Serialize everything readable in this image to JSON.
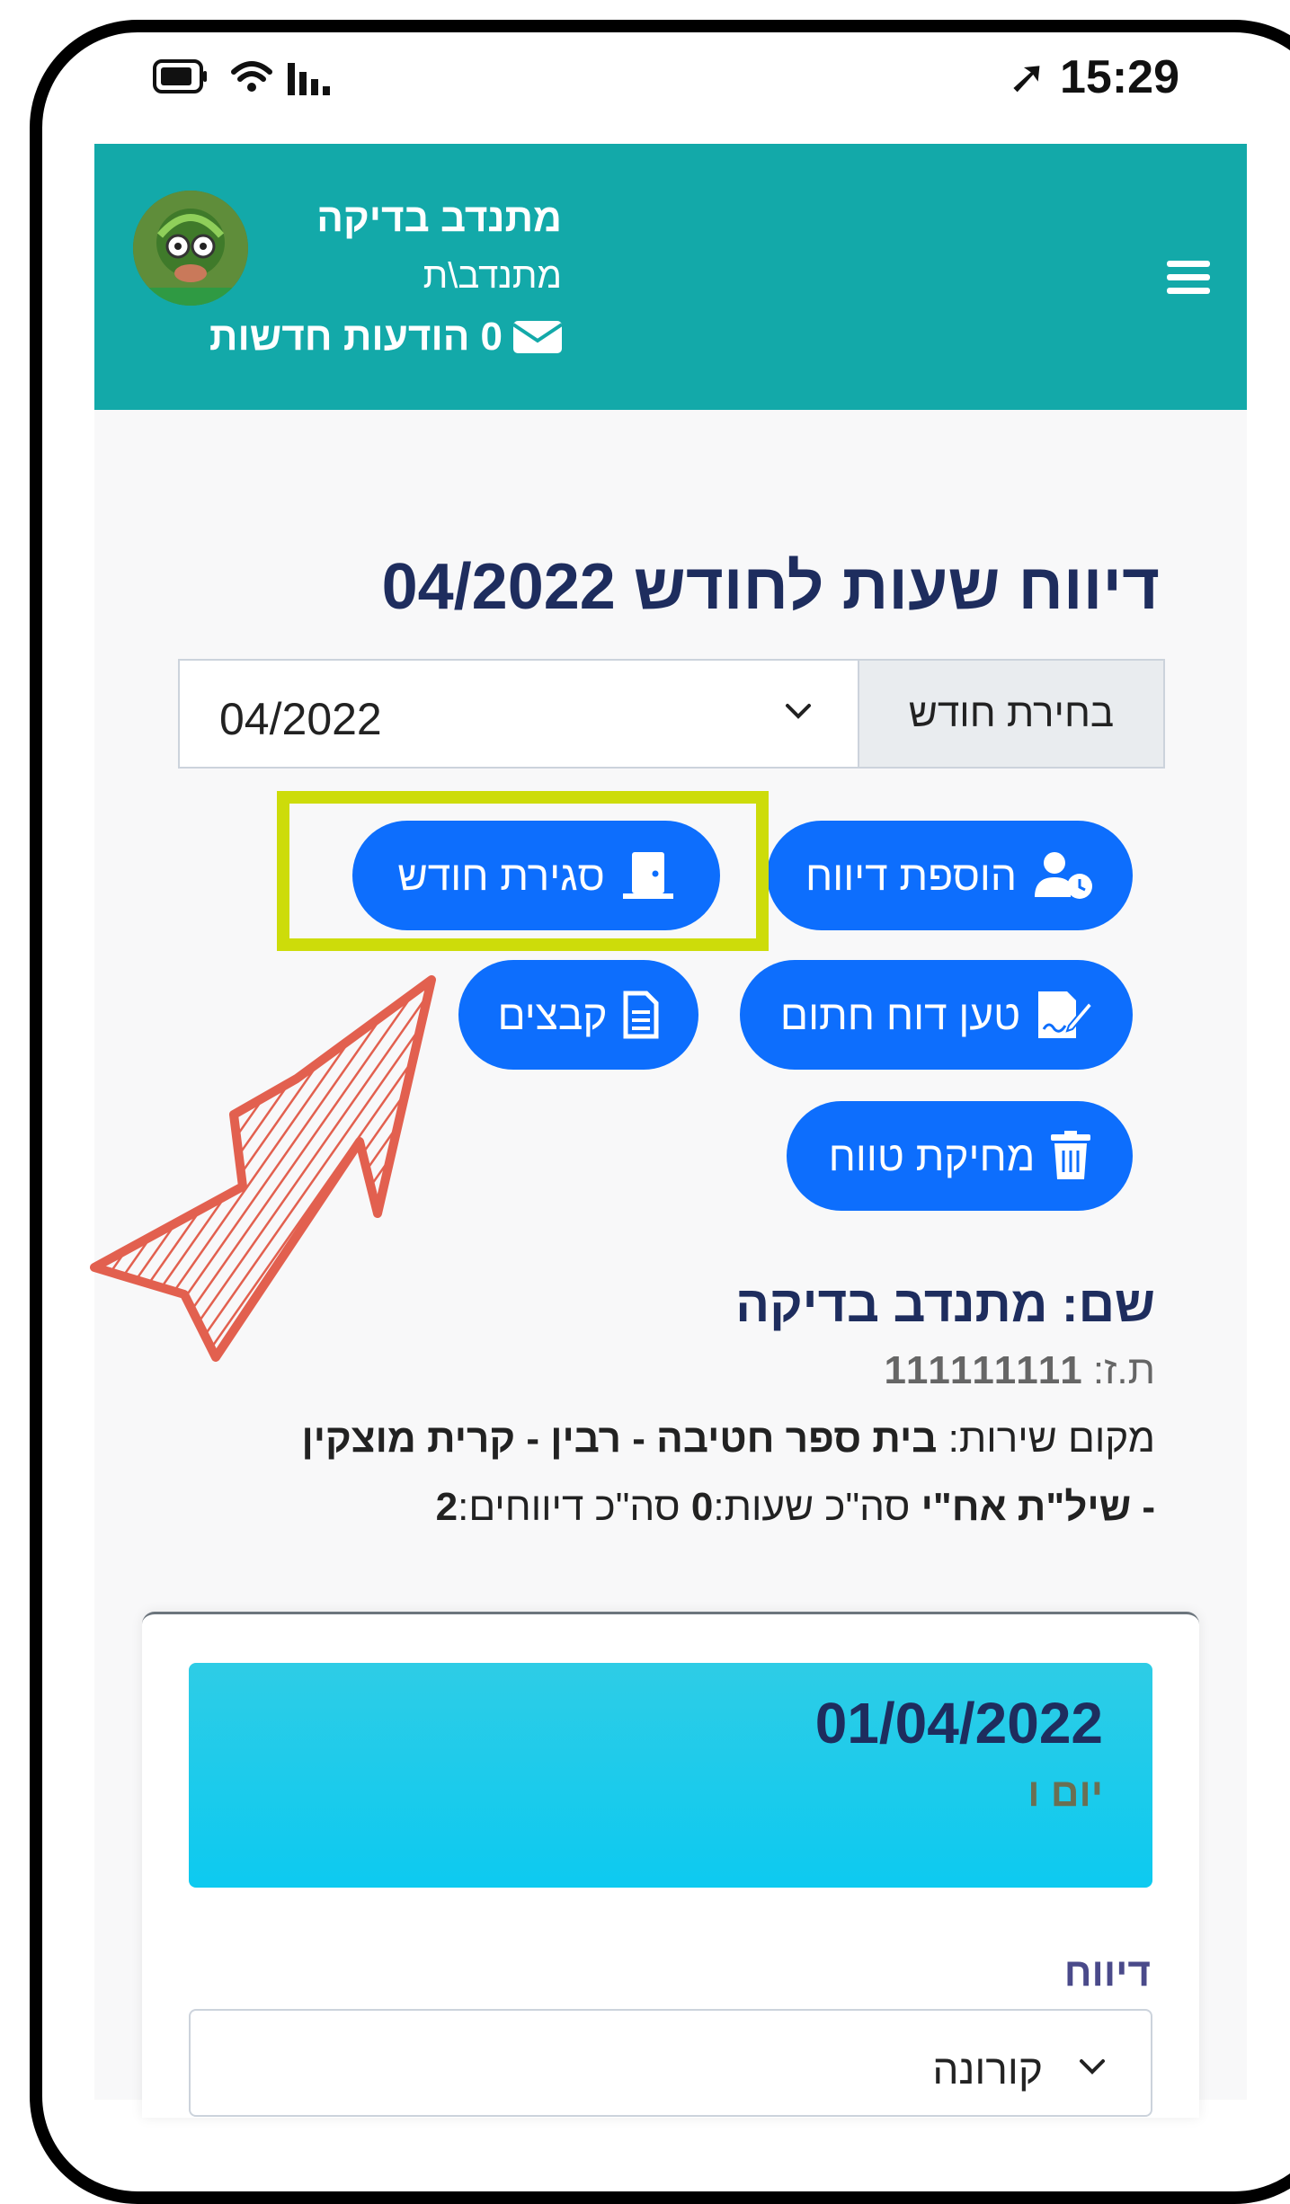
{
  "status_bar": {
    "time": "15:29"
  },
  "header": {
    "user_name": "מתנדב בדיקה",
    "user_role": "מתנדב\\ת",
    "messages_count": "0",
    "messages_label": "הודעות חדשות"
  },
  "page": {
    "title": "דיווח שעות לחודש 04/2022",
    "month_select_label": "בחירת חודש",
    "month_select_value": "04/2022"
  },
  "buttons": {
    "add_report": "הוספת דיווח",
    "close_month": "סגירת חודש",
    "upload_signed": "טען דוח חתום",
    "files": "קבצים",
    "delete_range": "מחיקת טווח"
  },
  "info": {
    "name_label": "שם:",
    "name_value": "מתנדב בדיקה",
    "id_label": "ת.ז:",
    "id_value": "111111111",
    "service_label": "מקום שירות:",
    "service_value_line1": "בית ספר חטיבה - רבין - קרית מוצקין",
    "service_value_line2": "- שיל\"ת אח\"י",
    "total_hours_label": "סה\"כ שעות:",
    "total_hours_value": "0",
    "total_reports_label": "סה\"כ דיווחים:",
    "total_reports_value": "2"
  },
  "report_card": {
    "date": "01/04/2022",
    "day_name": "יום ו",
    "report_label": "דיווח",
    "report_type_value": "קורונה"
  },
  "colors": {
    "header_bg": "#13a9a9",
    "button_bg": "#0d6efd",
    "highlight": "#cddc0a",
    "annotation_arrow": "#e2604f",
    "day_box": "#0dcaf0",
    "title": "#1e2d5e"
  }
}
